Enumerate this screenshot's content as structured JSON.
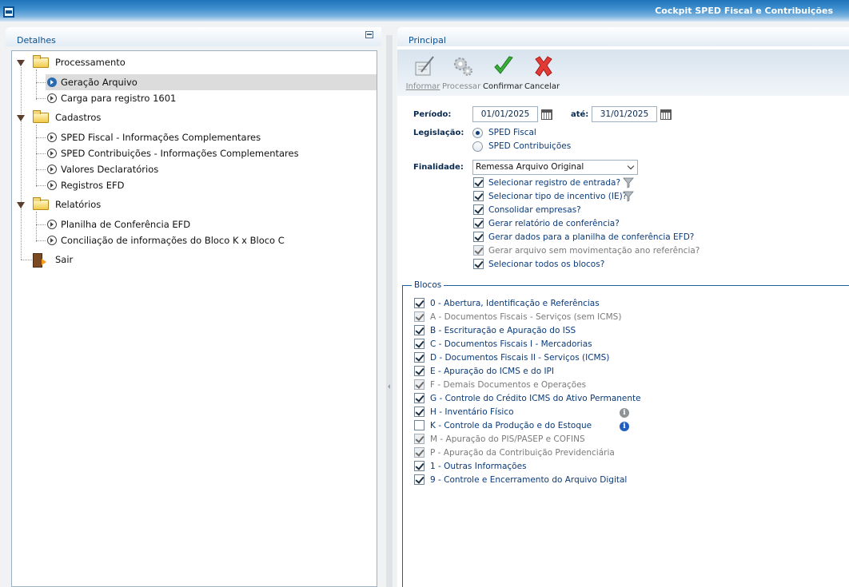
{
  "window": {
    "title": "Cockpit SPED Fiscal e Contribuições"
  },
  "left_panel": {
    "header": "Detalhes",
    "tree": [
      {
        "label": "Processamento",
        "type": "folder"
      },
      {
        "label": "Geração Arquivo",
        "type": "item",
        "selected": true
      },
      {
        "label": "Carga para registro 1601",
        "type": "item"
      },
      {
        "label": "Cadastros",
        "type": "folder"
      },
      {
        "label": "SPED Fiscal - Informações Complementares",
        "type": "item"
      },
      {
        "label": "SPED Contribuições - Informações Complementares",
        "type": "item"
      },
      {
        "label": "Valores Declaratórios",
        "type": "item"
      },
      {
        "label": "Registros EFD",
        "type": "item"
      },
      {
        "label": "Relatórios",
        "type": "folder"
      },
      {
        "label": "Planilha de Conferência EFD",
        "type": "item"
      },
      {
        "label": "Conciliação de informações do Bloco K x Bloco C",
        "type": "item"
      },
      {
        "label": "Sair",
        "type": "exit"
      }
    ]
  },
  "right_panel": {
    "header": "Principal",
    "toolbar": [
      {
        "label": "Informar",
        "enabled": false,
        "icon": "pencil-paper-icon"
      },
      {
        "label": "Processar",
        "enabled": false,
        "icon": "gears-icon"
      },
      {
        "label": "Confirmar",
        "enabled": true,
        "icon": "green-check-icon"
      },
      {
        "label": "Cancelar",
        "enabled": true,
        "icon": "red-x-icon"
      }
    ],
    "periodo": {
      "label": "Período:",
      "from": "01/01/2025",
      "ate_label": "até:",
      "to": "31/01/2025"
    },
    "legislacao": {
      "label": "Legislação:",
      "options": [
        {
          "label": "SPED Fiscal",
          "selected": true
        },
        {
          "label": "SPED Contribuições",
          "selected": false
        }
      ]
    },
    "finalidade": {
      "label": "Finalidade:",
      "value": "Remessa Arquivo Original"
    },
    "checks": [
      {
        "label": "Selecionar registro de entrada?",
        "checked": true,
        "disabled": false,
        "filter": true
      },
      {
        "label": "Selecionar tipo de incentivo (IE)?",
        "checked": true,
        "disabled": false,
        "filter": true
      },
      {
        "label": "Consolidar empresas?",
        "checked": true,
        "disabled": false
      },
      {
        "label": "Gerar relatório de conferência?",
        "checked": true,
        "disabled": false
      },
      {
        "label": "Gerar dados para a planilha de conferência EFD?",
        "checked": true,
        "disabled": false
      },
      {
        "label": "Gerar arquivo sem movimentação ano referência?",
        "checked": true,
        "disabled": true
      },
      {
        "label": "Selecionar todos os blocos?",
        "checked": true,
        "disabled": false
      }
    ],
    "blocos": {
      "legend": "Blocos",
      "items": [
        {
          "label": "0 - Abertura, Identificação  e Referências",
          "checked": true,
          "disabled": false
        },
        {
          "label": "A - Documentos Fiscais -  Serviços (sem ICMS)",
          "checked": true,
          "disabled": true
        },
        {
          "label": "B - Escrituração e Apuração do ISS",
          "checked": true,
          "disabled": false
        },
        {
          "label": "C - Documentos Fiscais I - Mercadorias",
          "checked": true,
          "disabled": false
        },
        {
          "label": "D - Documentos Fiscais II - Serviços (ICMS)",
          "checked": true,
          "disabled": false
        },
        {
          "label": "E - Apuração do ICMS e do IPI",
          "checked": true,
          "disabled": false
        },
        {
          "label": "F - Demais Documentos e Operações",
          "checked": true,
          "disabled": true
        },
        {
          "label": "G - Controle do Crédito ICMS do Ativo Permanente",
          "checked": true,
          "disabled": false
        },
        {
          "label": "H - Inventário Físico",
          "checked": true,
          "disabled": false,
          "info": "grey"
        },
        {
          "label": "K - Controle da Produção e do Estoque",
          "checked": false,
          "disabled": false,
          "info": "blue"
        },
        {
          "label": "M - Apuração do PIS/PASEP e COFINS",
          "checked": true,
          "disabled": true
        },
        {
          "label": "P - Apuração da Contribuição Previdenciária",
          "checked": true,
          "disabled": true
        },
        {
          "label": "1 - Outras Informações",
          "checked": true,
          "disabled": false
        },
        {
          "label": "9 - Controle e Encerramento do Arquivo Digital",
          "checked": true,
          "disabled": false
        }
      ]
    }
  }
}
